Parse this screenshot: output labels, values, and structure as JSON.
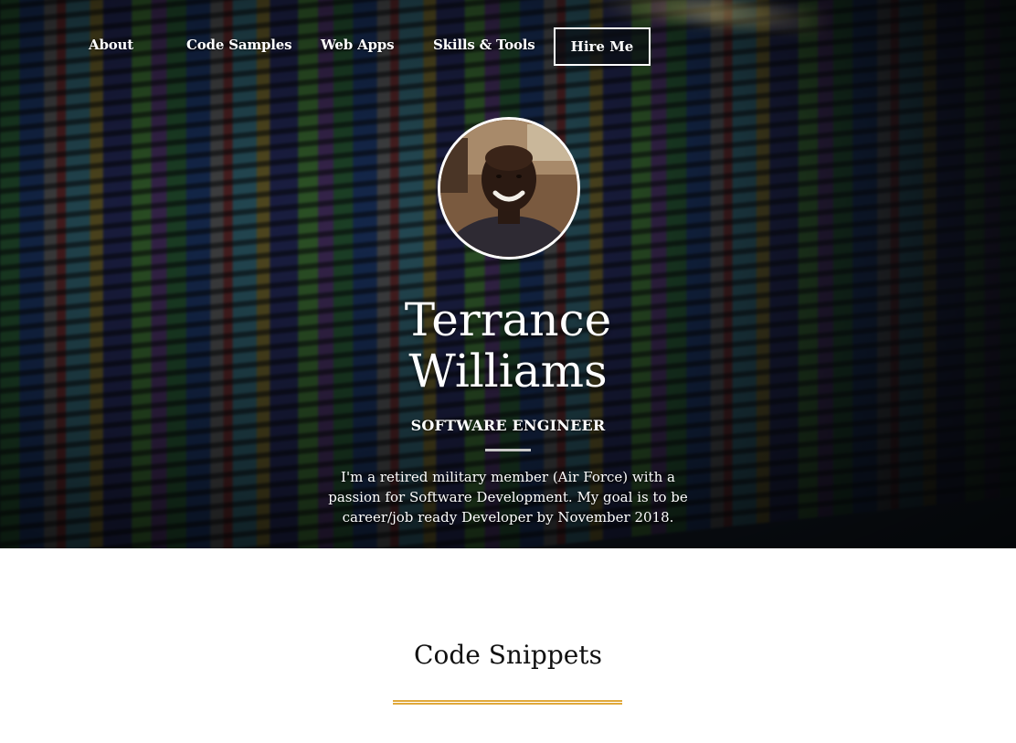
{
  "nav": {
    "items": [
      {
        "label": "About"
      },
      {
        "label": "Code Samples"
      },
      {
        "label": "Web Apps"
      },
      {
        "label": "Skills & Tools"
      }
    ],
    "hire_label": "Hire Me"
  },
  "hero": {
    "name_first": "Terrance",
    "name_last": "Williams",
    "title": "SOFTWARE ENGINEER",
    "bio": "I'm a retired military member (Air Force) with a passion for Software Development. My goal is to be career/job ready Developer by November 2018.",
    "avatar_icon": "profile-photo"
  },
  "section": {
    "heading": "Code Snippets",
    "accent_color": "#e0a93c"
  },
  "colors": {
    "hero_text": "#ffffff",
    "accent": "#e0a93c",
    "divider": "#c9c9c9"
  }
}
